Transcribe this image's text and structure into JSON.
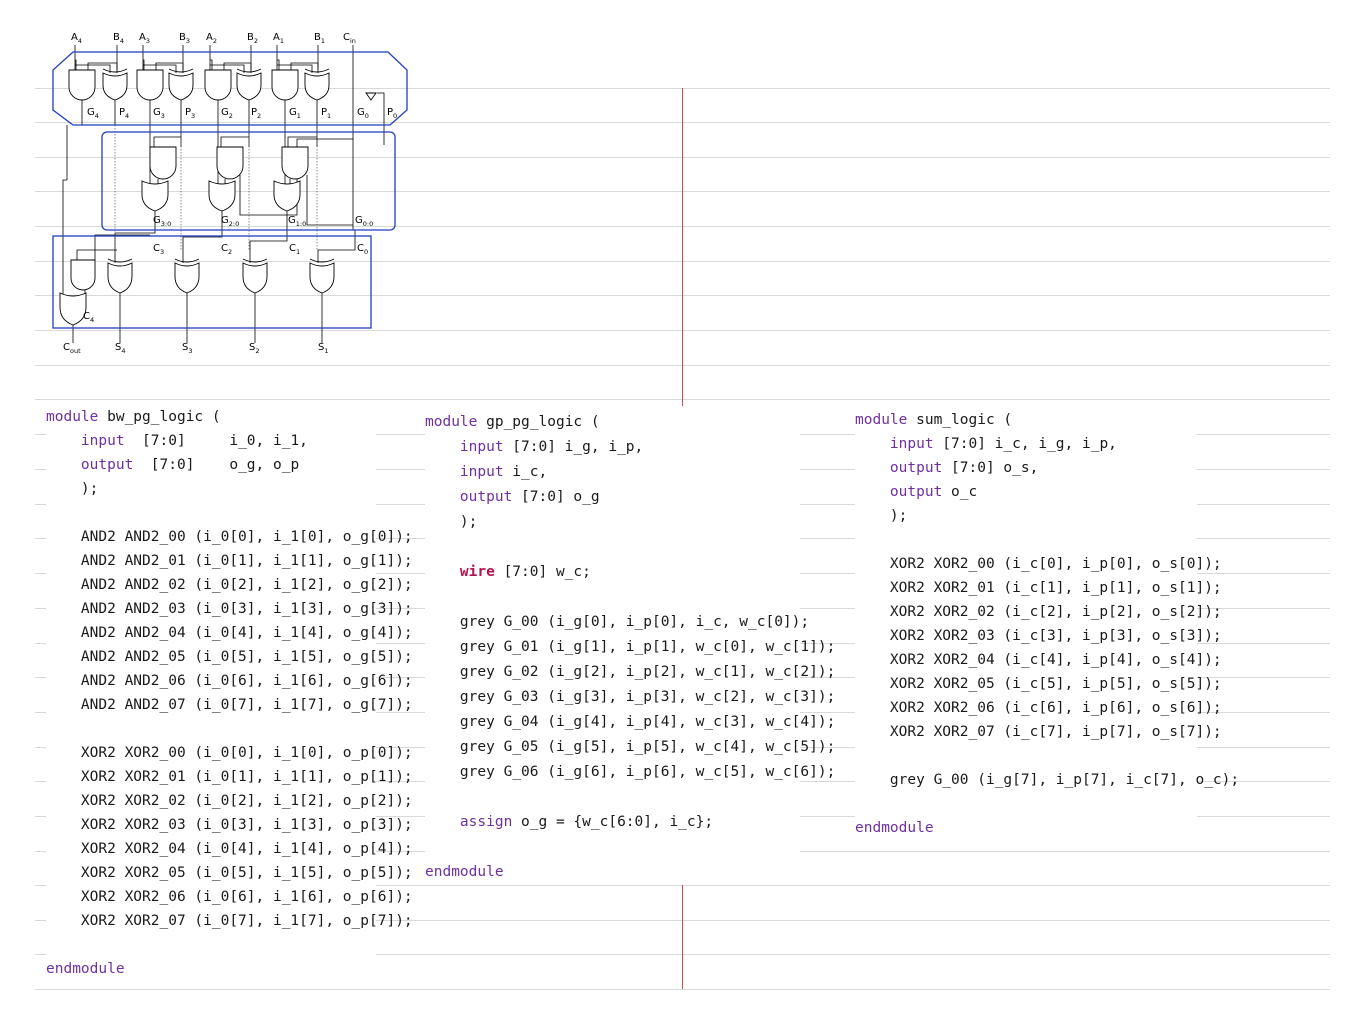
{
  "diagram": {
    "top_inputs": [
      {
        "letter": "A",
        "sub": "4"
      },
      {
        "letter": "B",
        "sub": "4"
      },
      {
        "letter": "A",
        "sub": "3"
      },
      {
        "letter": "B",
        "sub": "3"
      },
      {
        "letter": "A",
        "sub": "2"
      },
      {
        "letter": "B",
        "sub": "2"
      },
      {
        "letter": "A",
        "sub": "1"
      },
      {
        "letter": "B",
        "sub": "1"
      },
      {
        "letter": "C",
        "sub": "in"
      }
    ],
    "gp_labels": [
      {
        "letter": "G",
        "sub": "4"
      },
      {
        "letter": "P",
        "sub": "4"
      },
      {
        "letter": "G",
        "sub": "3"
      },
      {
        "letter": "P",
        "sub": "3"
      },
      {
        "letter": "G",
        "sub": "2"
      },
      {
        "letter": "P",
        "sub": "2"
      },
      {
        "letter": "G",
        "sub": "1"
      },
      {
        "letter": "P",
        "sub": "1"
      },
      {
        "letter": "G",
        "sub": "0"
      },
      {
        "letter": "P",
        "sub": "0"
      }
    ],
    "group_labels": [
      {
        "letter": "G",
        "sub": "3:0"
      },
      {
        "letter": "G",
        "sub": "2:0"
      },
      {
        "letter": "G",
        "sub": "1:0"
      },
      {
        "letter": "G",
        "sub": "0:0"
      }
    ],
    "carry_labels": [
      {
        "letter": "C",
        "sub": "3"
      },
      {
        "letter": "C",
        "sub": "2"
      },
      {
        "letter": "C",
        "sub": "1"
      },
      {
        "letter": "C",
        "sub": "0"
      },
      {
        "letter": "C",
        "sub": "4"
      }
    ],
    "outputs": [
      {
        "letter": "C",
        "sub": "out"
      },
      {
        "letter": "S",
        "sub": "4"
      },
      {
        "letter": "S",
        "sub": "3"
      },
      {
        "letter": "S",
        "sub": "2"
      },
      {
        "letter": "S",
        "sub": "1"
      }
    ]
  },
  "code_blocks": [
    {
      "lines": [
        [
          {
            "t": "module",
            "k": "kw"
          },
          {
            "t": " bw_pg_logic ("
          }
        ],
        [
          {
            "t": "    "
          },
          {
            "t": "input",
            "k": "kw"
          },
          {
            "t": "  [7:0]     i_0, i_1,"
          }
        ],
        [
          {
            "t": "    "
          },
          {
            "t": "output",
            "k": "kw"
          },
          {
            "t": "  [7:0]    o_g, o_p"
          }
        ],
        [
          {
            "t": "    );"
          }
        ],
        [
          {
            "t": ""
          }
        ],
        [
          {
            "t": "    AND2 AND2_00 (i_0[0], i_1[0], o_g[0]);"
          }
        ],
        [
          {
            "t": "    AND2 AND2_01 (i_0[1], i_1[1], o_g[1]);"
          }
        ],
        [
          {
            "t": "    AND2 AND2_02 (i_0[2], i_1[2], o_g[2]);"
          }
        ],
        [
          {
            "t": "    AND2 AND2_03 (i_0[3], i_1[3], o_g[3]);"
          }
        ],
        [
          {
            "t": "    AND2 AND2_04 (i_0[4], i_1[4], o_g[4]);"
          }
        ],
        [
          {
            "t": "    AND2 AND2_05 (i_0[5], i_1[5], o_g[5]);"
          }
        ],
        [
          {
            "t": "    AND2 AND2_06 (i_0[6], i_1[6], o_g[6]);"
          }
        ],
        [
          {
            "t": "    AND2 AND2_07 (i_0[7], i_1[7], o_g[7]);"
          }
        ],
        [
          {
            "t": ""
          }
        ],
        [
          {
            "t": "    XOR2 XOR2_00 (i_0[0], i_1[0], o_p[0]);"
          }
        ],
        [
          {
            "t": "    XOR2 XOR2_01 (i_0[1], i_1[1], o_p[1]);"
          }
        ],
        [
          {
            "t": "    XOR2 XOR2_02 (i_0[2], i_1[2], o_p[2]);"
          }
        ],
        [
          {
            "t": "    XOR2 XOR2_03 (i_0[3], i_1[3], o_p[3]);"
          }
        ],
        [
          {
            "t": "    XOR2 XOR2_04 (i_0[4], i_1[4], o_p[4]);"
          }
        ],
        [
          {
            "t": "    XOR2 XOR2_05 (i_0[5], i_1[5], o_p[5]);"
          }
        ],
        [
          {
            "t": "    XOR2 XOR2_06 (i_0[6], i_1[6], o_p[6]);"
          }
        ],
        [
          {
            "t": "    XOR2 XOR2_07 (i_0[7], i_1[7], o_p[7]);"
          }
        ],
        [
          {
            "t": ""
          }
        ],
        [
          {
            "t": "endmodule",
            "k": "kw"
          }
        ]
      ]
    },
    {
      "lines": [
        [
          {
            "t": "module",
            "k": "kw"
          },
          {
            "t": " gp_pg_logic ("
          }
        ],
        [
          {
            "t": "    "
          },
          {
            "t": "input",
            "k": "kw"
          },
          {
            "t": " [7:0] i_g, i_p,"
          }
        ],
        [
          {
            "t": "    "
          },
          {
            "t": "input",
            "k": "kw"
          },
          {
            "t": " i_c,"
          }
        ],
        [
          {
            "t": "    "
          },
          {
            "t": "output",
            "k": "kw"
          },
          {
            "t": " [7:0] o_g"
          }
        ],
        [
          {
            "t": "    );"
          }
        ],
        [
          {
            "t": ""
          }
        ],
        [
          {
            "t": "    "
          },
          {
            "t": "wire",
            "k": "kw-wire"
          },
          {
            "t": " [7:0] w_c;"
          }
        ],
        [
          {
            "t": ""
          }
        ],
        [
          {
            "t": "    grey G_00 (i_g[0], i_p[0], i_c, w_c[0]);"
          }
        ],
        [
          {
            "t": "    grey G_01 (i_g[1], i_p[1], w_c[0], w_c[1]);"
          }
        ],
        [
          {
            "t": "    grey G_02 (i_g[2], i_p[2], w_c[1], w_c[2]);"
          }
        ],
        [
          {
            "t": "    grey G_03 (i_g[3], i_p[3], w_c[2], w_c[3]);"
          }
        ],
        [
          {
            "t": "    grey G_04 (i_g[4], i_p[4], w_c[3], w_c[4]);"
          }
        ],
        [
          {
            "t": "    grey G_05 (i_g[5], i_p[5], w_c[4], w_c[5]);"
          }
        ],
        [
          {
            "t": "    grey G_06 (i_g[6], i_p[6], w_c[5], w_c[6]);"
          }
        ],
        [
          {
            "t": ""
          }
        ],
        [
          {
            "t": "    "
          },
          {
            "t": "assign",
            "k": "kw"
          },
          {
            "t": " o_g = {w_c[6:0], i_c};"
          }
        ],
        [
          {
            "t": ""
          }
        ],
        [
          {
            "t": "endmodule",
            "k": "kw"
          }
        ]
      ]
    },
    {
      "lines": [
        [
          {
            "t": "module",
            "k": "kw"
          },
          {
            "t": " sum_logic ("
          }
        ],
        [
          {
            "t": "    "
          },
          {
            "t": "input",
            "k": "kw"
          },
          {
            "t": " [7:0] i_c, i_g, i_p,"
          }
        ],
        [
          {
            "t": "    "
          },
          {
            "t": "output",
            "k": "kw"
          },
          {
            "t": " [7:0] o_s,"
          }
        ],
        [
          {
            "t": "    "
          },
          {
            "t": "output",
            "k": "kw"
          },
          {
            "t": " o_c"
          }
        ],
        [
          {
            "t": "    );"
          }
        ],
        [
          {
            "t": ""
          }
        ],
        [
          {
            "t": "    XOR2 XOR2_00 (i_c[0], i_p[0], o_s[0]);"
          }
        ],
        [
          {
            "t": "    XOR2 XOR2_01 (i_c[1], i_p[1], o_s[1]);"
          }
        ],
        [
          {
            "t": "    XOR2 XOR2_02 (i_c[2], i_p[2], o_s[2]);"
          }
        ],
        [
          {
            "t": "    XOR2 XOR2_03 (i_c[3], i_p[3], o_s[3]);"
          }
        ],
        [
          {
            "t": "    XOR2 XOR2_04 (i_c[4], i_p[4], o_s[4]);"
          }
        ],
        [
          {
            "t": "    XOR2 XOR2_05 (i_c[5], i_p[5], o_s[5]);"
          }
        ],
        [
          {
            "t": "    XOR2 XOR2_06 (i_c[6], i_p[6], o_s[6]);"
          }
        ],
        [
          {
            "t": "    XOR2 XOR2_07 (i_c[7], i_p[7], o_s[7]);"
          }
        ],
        [
          {
            "t": ""
          }
        ],
        [
          {
            "t": "    grey G_00 (i_g[7], i_p[7], i_c[7], o_c);"
          }
        ],
        [
          {
            "t": ""
          }
        ],
        [
          {
            "t": "endmodule",
            "k": "kw"
          }
        ]
      ]
    }
  ],
  "colors": {
    "keyword": "#7030a0",
    "wire_keyword": "#b5134e",
    "box_outline": "#1f3fbf",
    "margin_line": "#c0504d",
    "rule_line": "#d9d9d9"
  }
}
